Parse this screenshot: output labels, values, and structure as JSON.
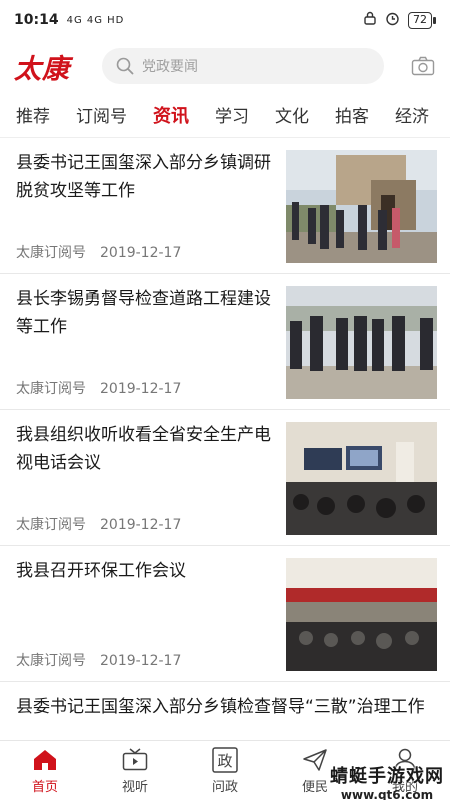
{
  "status": {
    "time": "10:14",
    "signal_text": "4G 4G HD",
    "battery": "72"
  },
  "header": {
    "logo": "太康",
    "search_placeholder": "党政要闻"
  },
  "tabs": [
    {
      "label": "推荐"
    },
    {
      "label": "订阅号"
    },
    {
      "label": "资讯",
      "active": true
    },
    {
      "label": "学习"
    },
    {
      "label": "文化"
    },
    {
      "label": "拍客"
    },
    {
      "label": "经济"
    }
  ],
  "articles": [
    {
      "title": "县委书记王国玺深入部分乡镇调研脱贫攻坚等工作",
      "source": "太康订阅号",
      "date": "2019-12-17",
      "thumb": "village-visit-photo"
    },
    {
      "title": "县长李锡勇督导检查道路工程建设等工作",
      "source": "太康订阅号",
      "date": "2019-12-17",
      "thumb": "officials-outdoor-photo"
    },
    {
      "title": "我县组织收听收看全省安全生产电视电话会议",
      "source": "太康订阅号",
      "date": "2019-12-17",
      "thumb": "meeting-hall-screens-photo"
    },
    {
      "title": "我县召开环保工作会议",
      "source": "太康订阅号",
      "date": "2019-12-17",
      "thumb": "meeting-hall-photo"
    },
    {
      "title": "县委书记王国玺深入部分乡镇检查督导“三散”治理工作",
      "source": "",
      "date": "",
      "thumb": ""
    }
  ],
  "bottom_nav": [
    {
      "label": "首页",
      "icon": "home-icon",
      "active": true
    },
    {
      "label": "视听",
      "icon": "tv-icon"
    },
    {
      "label": "问政",
      "icon": "zheng-icon",
      "glyph": "政"
    },
    {
      "label": "便民",
      "icon": "paper-plane-icon"
    },
    {
      "label": "我的",
      "icon": "user-icon"
    }
  ],
  "watermark": {
    "line1": "蜻蜓手游戏网",
    "line2": "www.qt6.com"
  },
  "colors": {
    "accent": "#d0121b"
  }
}
